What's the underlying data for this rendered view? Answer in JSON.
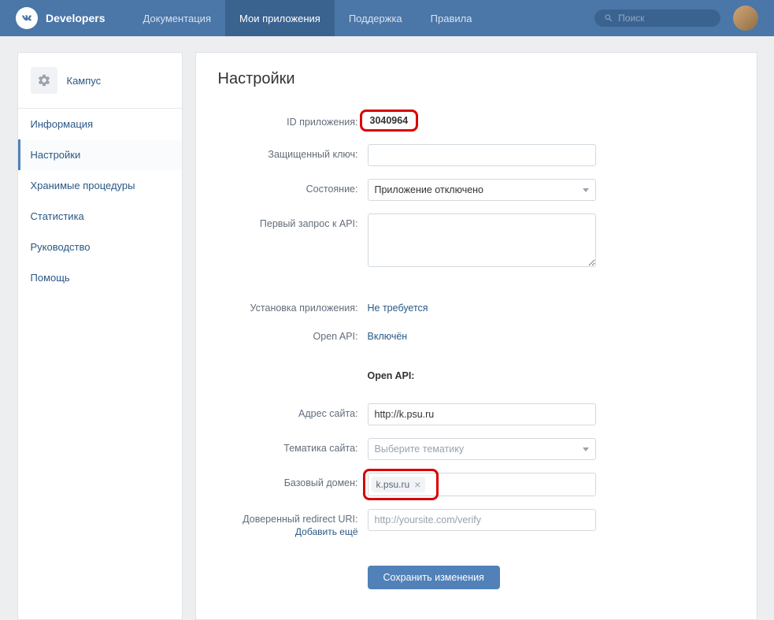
{
  "header": {
    "brand": "Developers",
    "nav": [
      "Документация",
      "Мои приложения",
      "Поддержка",
      "Правила"
    ],
    "active_nav_index": 1,
    "search_placeholder": "Поиск"
  },
  "sidebar": {
    "app_name": "Кампус",
    "items": [
      "Информация",
      "Настройки",
      "Хранимые процедуры",
      "Статистика",
      "Руководство",
      "Помощь"
    ],
    "active_index": 1
  },
  "page": {
    "title": "Настройки",
    "fields": {
      "app_id_label": "ID приложения:",
      "app_id_value": "3040964",
      "secret_key_label": "Защищенный ключ:",
      "secret_key_value": "",
      "status_label": "Состояние:",
      "status_value": "Приложение отключено",
      "first_api_label": "Первый запрос к API:",
      "first_api_value": "",
      "install_label": "Установка приложения:",
      "install_value": "Не требуется",
      "open_api_label": "Open API:",
      "open_api_value": "Включён",
      "section_heading": "Open API:",
      "site_address_label": "Адрес сайта:",
      "site_address_value": "http://k.psu.ru",
      "site_theme_label": "Тематика сайта:",
      "site_theme_placeholder": "Выберите тематику",
      "base_domain_label": "Базовый домен:",
      "base_domain_tag": "k.psu.ru",
      "redirect_label": "Доверенный redirect URI:",
      "redirect_placeholder": "http://yoursite.com/verify",
      "add_more": "Добавить ещё",
      "save_button": "Сохранить изменения"
    }
  }
}
